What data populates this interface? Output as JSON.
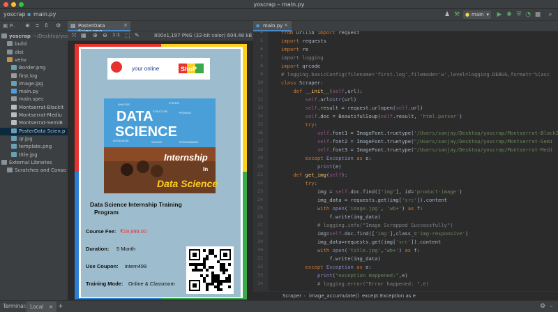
{
  "window": {
    "title": "yoscrap – main.py"
  },
  "navbar": {
    "project": "yoscrap",
    "file": "main.py",
    "run_config": "main"
  },
  "tabs": {
    "project_label": "P..",
    "image_tab": "PosterData Scien.png",
    "code_tab": "main.py"
  },
  "image_info": "800x1,197 PNG (32-bit color) 604.48 kB",
  "project_tree": [
    {
      "label": "yoscrap",
      "suffix": "~/Desktop/yoscrap",
      "type": "folder"
    },
    {
      "label": "build",
      "type": "folder"
    },
    {
      "label": "dist",
      "type": "folder"
    },
    {
      "label": "venv",
      "type": "folder-venv"
    },
    {
      "label": "Border.png",
      "type": "image"
    },
    {
      "label": "first.log",
      "type": "text"
    },
    {
      "label": "image.jpg",
      "type": "image"
    },
    {
      "label": "main.py",
      "type": "python"
    },
    {
      "label": "main.spec",
      "type": "text"
    },
    {
      "label": "Montserrat-BlackIt",
      "type": "font"
    },
    {
      "label": "Montserrat-Mediu",
      "type": "font"
    },
    {
      "label": "Montserrat-SemiB",
      "type": "font"
    },
    {
      "label": "PosterData Scien.p",
      "type": "image"
    },
    {
      "label": "qr.jpg",
      "type": "image"
    },
    {
      "label": "template.png",
      "type": "image"
    },
    {
      "label": "title.jpg",
      "type": "image"
    },
    {
      "label": "External Libraries",
      "type": "lib"
    },
    {
      "label": "Scratches and Conso",
      "type": "scratch"
    }
  ],
  "poster": {
    "logo_text": "your online",
    "logo_shop": "ShoP",
    "banner_title_1": "DATA",
    "banner_title_2": "SCIENCE",
    "banner_tags": [
      "ANALYSIS",
      "SYSTEM",
      "STRUCTURE",
      "PROCESS",
      "KNOWLEDGE",
      "SOLVING",
      "PROGRAMMING"
    ],
    "photo_title_1": "Internship",
    "photo_title_2": "In",
    "photo_title_3": "Data Science",
    "heading": "Data Science Internship Training Program",
    "fee_label": "Course Fee:",
    "fee_value": "₹19,999.00",
    "duration_label": "Duration:",
    "duration_value": "5 Month",
    "coupon_label": "Use Coupon:",
    "coupon_value": "intern499",
    "mode_label": "Training Mode:",
    "mode_value": "Online & Classroom"
  },
  "code_lines": [
    {
      "n": "4",
      "html": "<span class=\"kw\">from</span> urllib <span class=\"kw\">import</span> request"
    },
    {
      "n": "5",
      "html": "<span class=\"kw\">import</span> requests"
    },
    {
      "n": "6",
      "html": "<span class=\"kw\">import</span> re"
    },
    {
      "n": "7",
      "html": "<span class=\"cm\">import logging</span>"
    },
    {
      "n": "8",
      "html": "<span class=\"kw\">import</span> qrcode"
    },
    {
      "n": "9",
      "html": "<span class=\"cm\"># logging.basicConfig(filename='first.log',filemode='w',level=logging.DEBUG,format='%(asc</span>"
    },
    {
      "n": "10",
      "html": "<span class=\"kw\">class</span> Scraper:"
    },
    {
      "n": "11",
      "html": "    <span class=\"kw\">def</span> <span class=\"fn\">__init__</span>(<span class=\"sf\">self</span>,url):"
    },
    {
      "n": "12",
      "html": "        <span class=\"sf\">self</span>.url=<span class=\"bi\">str</span>(url)"
    },
    {
      "n": "13",
      "html": "        <span class=\"sf\">self</span>.result = request.urlopen(<span class=\"sf\">self</span>.url)"
    },
    {
      "n": "14",
      "html": "        <span class=\"sf\">self</span>.doc = BeautifulSoup(<span class=\"sf\">self</span>.result, <span class=\"st\">'html.parser'</span>)"
    },
    {
      "n": "15",
      "html": "        <span class=\"kw\">try</span>:"
    },
    {
      "n": "16",
      "html": "            <span class=\"sf\">self</span>.font1 = ImageFont.truetype(<span class=\"st\">'/Users/sanjay/Desktop/yoscrap/Montserrat-BlackI</span>"
    },
    {
      "n": "17",
      "html": "            <span class=\"sf\">self</span>.font2 = ImageFont.truetype(<span class=\"st\">\"/Users/sanjay/Desktop/yoscrap/Montserrat-Semi</span>"
    },
    {
      "n": "18",
      "html": "            <span class=\"sf\">self</span>.font3 = ImageFont.truetype(<span class=\"st\">\"/Users/sanjay/Desktop/yoscrap/Montserrat-Medi</span>"
    },
    {
      "n": "19",
      "html": "        <span class=\"kw\">except</span> <span class=\"bi\">Exception</span> <span class=\"kw\">as</span> e:"
    },
    {
      "n": "20",
      "html": "            <span class=\"bi\">print</span>(e)"
    },
    {
      "n": "21",
      "html": "    <span class=\"kw\">def</span> <span class=\"fn\">get_img</span>(<span class=\"sf\">self</span>):"
    },
    {
      "n": "22",
      "html": "        <span class=\"kw\">try</span>:"
    },
    {
      "n": "23",
      "html": "            img = <span class=\"sf\">self</span>.doc.find([<span class=\"st\">\"img\"</span>], id=<span class=\"st\">'product-image'</span>)"
    },
    {
      "n": "24",
      "html": "            img_data = requests.get(img[<span class=\"st\">'src'</span>]).content"
    },
    {
      "n": "25",
      "html": "            <span class=\"kw\">with</span> <span class=\"bi\">open</span>(<span class=\"st\">'image.jpg'</span>, <span class=\"st\">'wb+'</span>) <span class=\"kw\">as</span> f:"
    },
    {
      "n": "26",
      "html": "                f.write(img_data)"
    },
    {
      "n": "27",
      "html": "            <span class=\"cm\"># logging.info(\"Image Scrapped Successfully\")</span>"
    },
    {
      "n": "28",
      "html": "            img=<span class=\"sf\">self</span>.doc.find([<span class=\"st\">'img'</span>],class_=<span class=\"st\">'img-responsive'</span>)"
    },
    {
      "n": "29",
      "html": "            img_data=requests.get(img[<span class=\"st\">'src'</span>]).content"
    },
    {
      "n": "30",
      "html": "            <span class=\"kw\">with</span> <span class=\"bi\">open</span>(<span class=\"st\">'title.jpg'</span>,<span class=\"st\">'wb+'</span>) <span class=\"kw\">as</span> f:"
    },
    {
      "n": "31",
      "html": "                f.write(img_data)"
    },
    {
      "n": "32",
      "html": "        <span class=\"kw\">except</span> <span class=\"bi\">Exception</span> <span class=\"kw\">as</span> e:"
    },
    {
      "n": "33",
      "html": "            <span class=\"bi\">print</span>(<span class=\"st\">\"exception Happened:\"</span>,e)"
    },
    {
      "n": "34",
      "html": "            <span class=\"cm\"># logging.error(\"Error happened: \",e)</span>"
    }
  ],
  "breadcrumbs": [
    "Scraper",
    "image_accumulate()",
    "except Exception as e"
  ],
  "terminal": {
    "label": "Terminal:",
    "tab": "Local",
    "add": "+"
  }
}
